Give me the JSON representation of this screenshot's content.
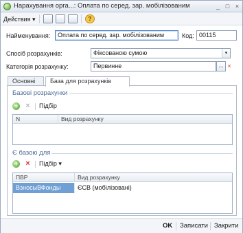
{
  "window": {
    "title": "Нарахування орга...: Оплата по серед. зар. мобілізованим"
  },
  "toolbar": {
    "actions_label": "Действия",
    "actions_arrow": "▾"
  },
  "form": {
    "name_label": "Найменування:",
    "name_value": "Оплата по серед. зар. мобілізованим",
    "code_label": "Код:",
    "code_value": "00115",
    "calc_method_label": "Спосіб розрахунків:",
    "calc_method_value": "Фіксованою сумою",
    "category_label": "Категорія розрахунку:",
    "category_value": "Первинне"
  },
  "tabs": [
    {
      "label": "Основні",
      "active": false
    },
    {
      "label": "База для розрахунків",
      "active": true
    }
  ],
  "base_section": {
    "title": "Базові розрахунки",
    "select_label": "Підбір",
    "columns": [
      "N",
      "Вид розрахунку"
    ],
    "rows": []
  },
  "is_base_section": {
    "title": "Є базою для",
    "select_label": "Підбір",
    "select_arrow": "▾",
    "columns": [
      "ПВР",
      "Вид розрахунку"
    ],
    "rows": [
      {
        "pvr": "ВзносыВФонды",
        "kind": "ЄСВ (мобілізовані)"
      }
    ]
  },
  "footer": {
    "ok": "OK",
    "save": "Записати",
    "close": "Закрити"
  },
  "icons": {
    "dropdown": "▾",
    "select": "...",
    "clear": "×",
    "add": "+",
    "delete": "×",
    "help": "?",
    "minimize": "_",
    "maximize": "□",
    "close": "×"
  }
}
